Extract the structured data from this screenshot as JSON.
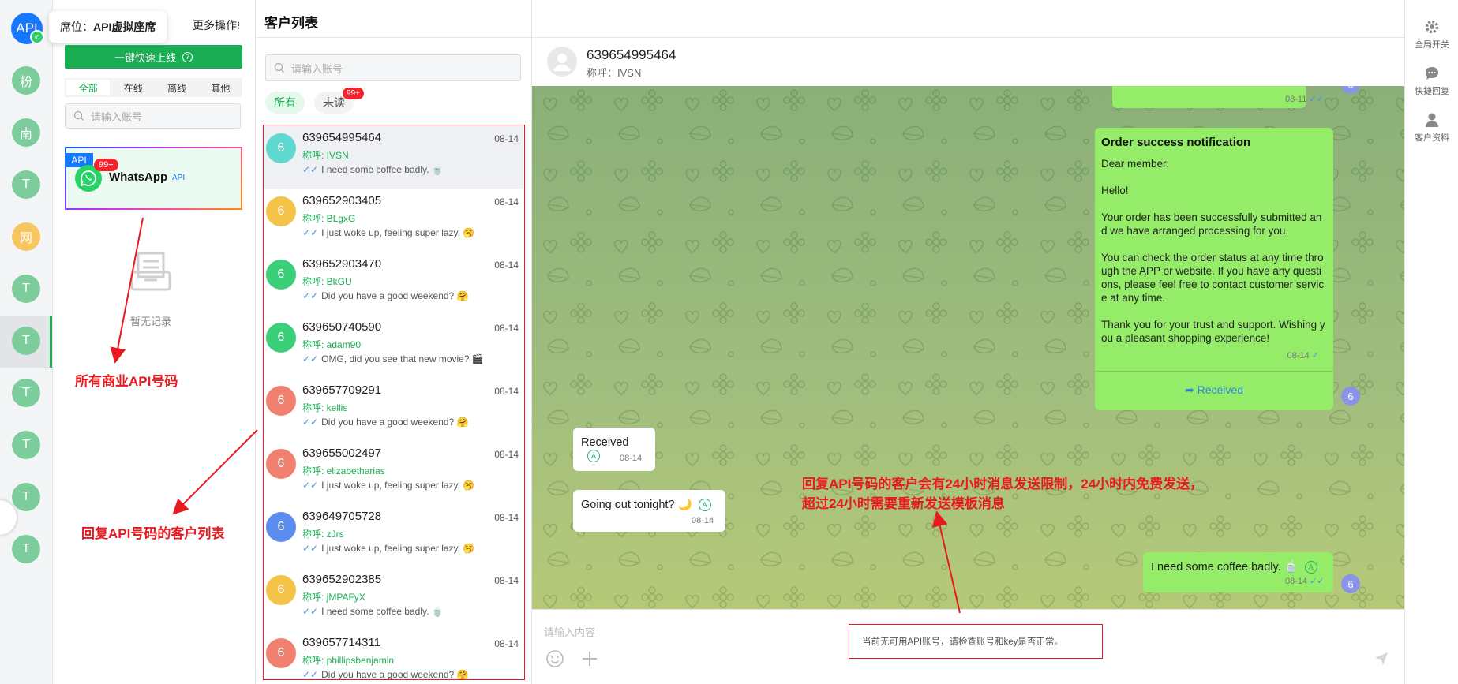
{
  "rail": {
    "top_avatar_label": "API",
    "items": [
      {
        "label": "粉",
        "color": "#7dcd9c"
      },
      {
        "label": "南",
        "color": "#7dcd9c"
      },
      {
        "label": "T",
        "color": "#7dcd9c"
      },
      {
        "label": "网",
        "color": "#f6c760"
      },
      {
        "label": "T",
        "color": "#7dcd9c"
      },
      {
        "label": "T",
        "color": "#7dcd9c"
      },
      {
        "label": "T",
        "color": "#7dcd9c"
      },
      {
        "label": "T",
        "color": "#7dcd9c"
      },
      {
        "label": "T",
        "color": "#7dcd9c"
      },
      {
        "label": "T",
        "color": "#7dcd9c"
      }
    ]
  },
  "seats": {
    "tooltip_prefix": "席位：",
    "tooltip_value": "API虚拟座席",
    "more_ops": "更多操作⁝",
    "online_button": "一键快速上线",
    "tabs": [
      "全部",
      "在线",
      "离线",
      "其他"
    ],
    "search_placeholder": "请输入账号",
    "card": {
      "tag": "API",
      "badge": "99+",
      "name": "WhatsApp",
      "sub": "API"
    },
    "empty_text": "暂无记录"
  },
  "annotations": {
    "api_numbers": "所有商业API号码",
    "reply_list": "回复API号码的客户列表",
    "limit_line1": "回复API号码的客户会有24小时消息发送限制，24小时内免费发送，",
    "limit_line2": "超过24小时需要重新发送模板消息"
  },
  "customer_list": {
    "title": "客户列表",
    "search_placeholder": "请输入账号",
    "tab_all": "所有",
    "tab_unread": "未读",
    "unread_badge": "99+",
    "nick_prefix": "称呼: ",
    "rows": [
      {
        "avatar": "6",
        "color": "#5fd8d0",
        "number": "639654995464",
        "nick": "称呼: IVSN",
        "date": "08-14",
        "msg": "I need some coffee badly. 🍵",
        "selected": true
      },
      {
        "avatar": "6",
        "color": "#f6c34a",
        "number": "639652903405",
        "nick": "称呼: BLgxG",
        "date": "08-14",
        "msg": "I just woke up, feeling super lazy. 🥱"
      },
      {
        "avatar": "6",
        "color": "#3ccf7a",
        "number": "639652903470",
        "nick": "称呼: BkGU",
        "date": "08-14",
        "msg": "Did you have a good weekend? 🤗"
      },
      {
        "avatar": "6",
        "color": "#3ccf7a",
        "number": "639650740590",
        "nick": "称呼: adam90",
        "date": "08-14",
        "msg": "OMG, did you see that new movie? 🎬"
      },
      {
        "avatar": "6",
        "color": "#f08070",
        "number": "639657709291",
        "nick": "称呼: kellis",
        "date": "08-14",
        "msg": "Did you have a good weekend? 🤗"
      },
      {
        "avatar": "6",
        "color": "#f08070",
        "number": "639655002497",
        "nick": "称呼: elizabetharias",
        "date": "08-14",
        "msg": "I just woke up, feeling super lazy. 🥱"
      },
      {
        "avatar": "6",
        "color": "#5b8def",
        "number": "639649705728",
        "nick": "称呼: zJrs",
        "date": "08-14",
        "msg": "I just woke up, feeling super lazy. 🥱"
      },
      {
        "avatar": "6",
        "color": "#f6c34a",
        "number": "639652902385",
        "nick": "称呼: jMPAFyX",
        "date": "08-14",
        "msg": "I need some coffee badly. 🍵"
      },
      {
        "avatar": "6",
        "color": "#f08070",
        "number": "639657714311",
        "nick": "称呼: phillipsbenjamin",
        "date": "08-14",
        "msg": "Did you have a good weekend? 🤗"
      }
    ]
  },
  "chat": {
    "number": "639654995464",
    "nick": "称呼：IVSN",
    "top_time": "08-11",
    "order": {
      "title": "Order success notification",
      "p1": "Dear member:",
      "p2": "Hello!",
      "p3": "Your order has been successfully submitted and we have arranged processing for you.",
      "p4": "You can check the order status at any time through the APP or website. If you have any questions, please feel free to contact customer service at any time.",
      "p5": "Thank you for your trust and support. Wishing you a pleasant shopping experience!",
      "time": "08-14",
      "received": "Received"
    },
    "in_msgs": [
      {
        "text": "Received",
        "time": "08-14"
      },
      {
        "text": "Going out tonight? 🌙",
        "time": "08-14"
      }
    ],
    "out_last": {
      "text": "I need some coffee badly. 🍵",
      "time": "08-14"
    },
    "avatar_label": "6",
    "input_placeholder": "请输入内容",
    "warning": "当前无可用API账号，请检查账号和key是否正常。"
  },
  "right_toolbar": [
    {
      "icon": "gear-icon",
      "label": "全局开关"
    },
    {
      "icon": "chat-bubble-icon",
      "label": "快捷回复"
    },
    {
      "icon": "user-icon",
      "label": "客户资料"
    }
  ]
}
